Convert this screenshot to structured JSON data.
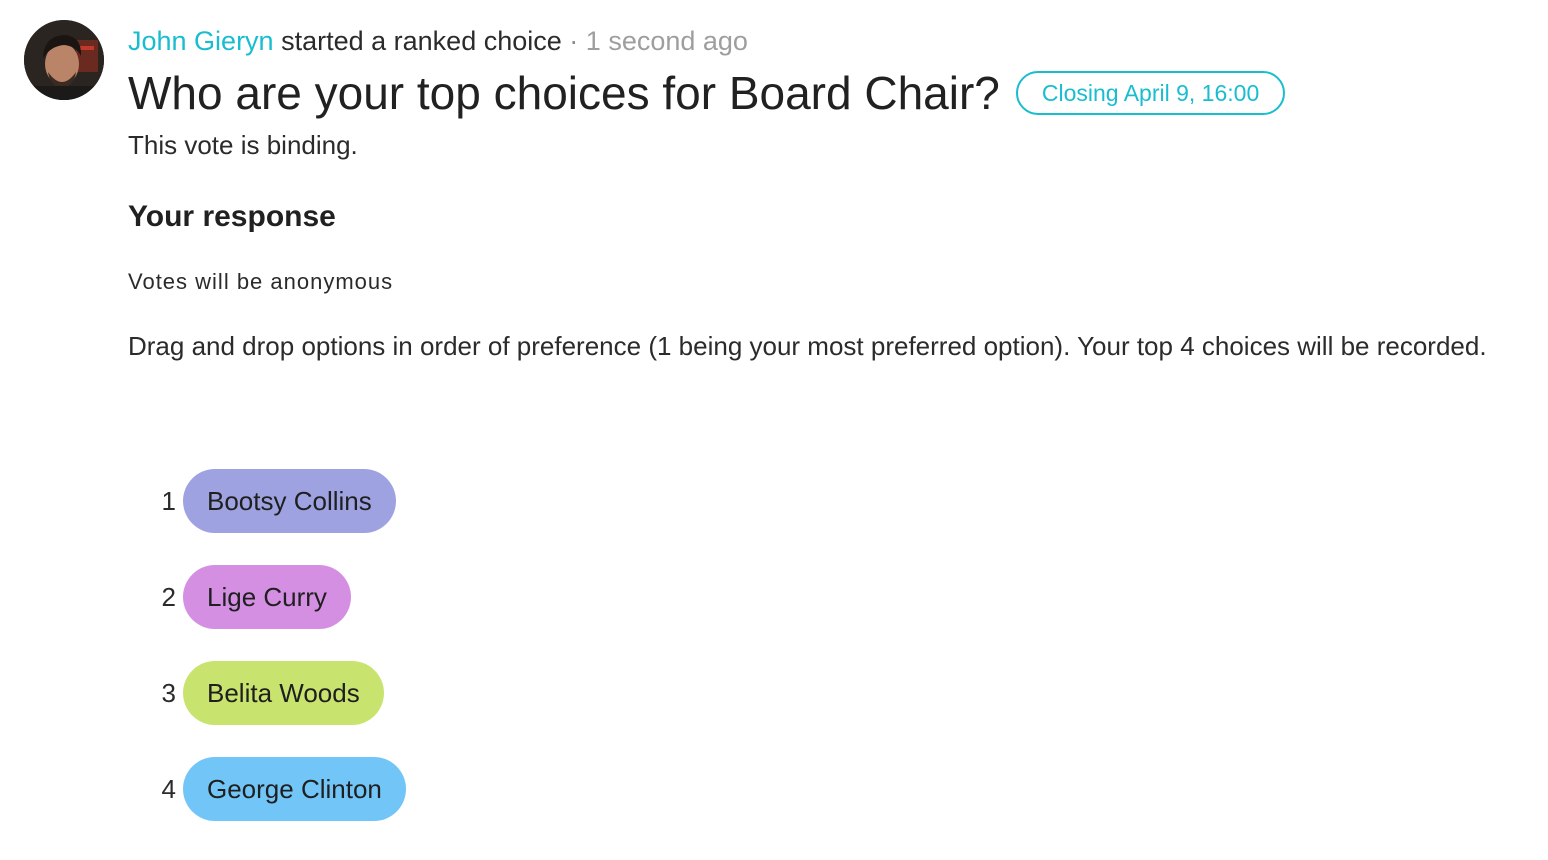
{
  "event": {
    "author_name": "John Gieryn",
    "action_text": "started a ranked choice",
    "separator": "·",
    "time_ago": "1 second ago"
  },
  "poll": {
    "title": "Who are your top choices for Board Chair?",
    "closing_label": "Closing April 9, 16:00",
    "details": "This vote is binding."
  },
  "response": {
    "heading": "Your response",
    "anonymity_note": "Votes will be anonymous",
    "instructions": "Drag and drop options in order of preference (1 being your most preferred option). Your top 4 choices will be recorded.",
    "options": [
      {
        "rank": "1",
        "name": "Bootsy Collins",
        "color": "#9ea2e0"
      },
      {
        "rank": "2",
        "name": "Lige Curry",
        "color": "#d48fe2"
      },
      {
        "rank": "3",
        "name": "Belita Woods",
        "color": "#c8e46e"
      },
      {
        "rank": "4",
        "name": "George Clinton",
        "color": "#72c6f7"
      }
    ]
  },
  "colors": {
    "accent": "#19bdd0",
    "text": "#212121",
    "muted": "#9e9e9e"
  }
}
